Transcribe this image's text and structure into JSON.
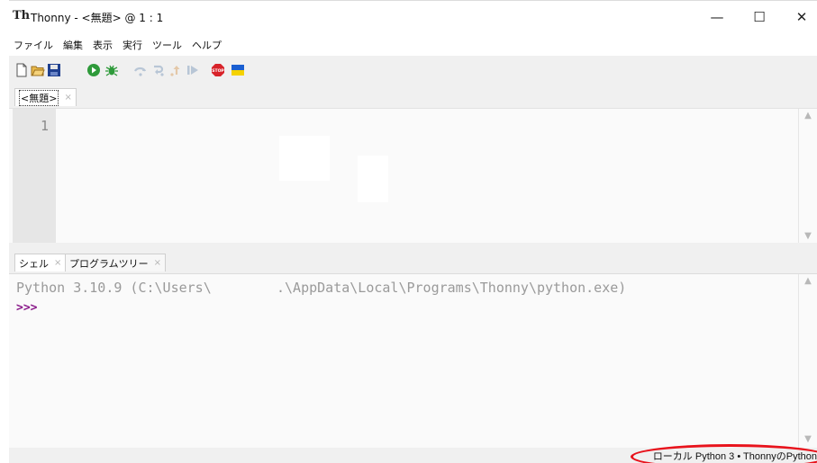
{
  "window": {
    "title": "Thonny  -  <無題>  @  1 : 1",
    "app_icon": "Th",
    "minimize": "—",
    "maximize": "☐",
    "close": "✕"
  },
  "menu": [
    "ファイル",
    "編集",
    "表示",
    "実行",
    "ツール",
    "ヘルプ"
  ],
  "toolbar_icons": [
    "new-file-icon",
    "open-folder-icon",
    "save-icon",
    "run-icon",
    "debug-icon",
    "step-over-icon",
    "step-into-icon",
    "step-out-icon",
    "resume-icon",
    "stop-icon",
    "ukraine-flag-icon"
  ],
  "editor": {
    "tab_label": "<無題>",
    "tab_close": "×",
    "line_number": "1"
  },
  "shell": {
    "tabs": [
      {
        "label": "シェル",
        "close": "×"
      },
      {
        "label": "プログラムツリー",
        "close": "×"
      }
    ],
    "banner": "Python 3.10.9 (C:\\Users\\        .\\AppData\\Local\\Programs\\Thonny\\python.exe)",
    "prompt": ">>>"
  },
  "status": {
    "interpreter": "ローカル Python 3  •  ThonnyのPython"
  },
  "colors": {
    "prompt": "#8a1a8a",
    "banner": "#9a9a9a",
    "annotation": "#e8131c"
  }
}
